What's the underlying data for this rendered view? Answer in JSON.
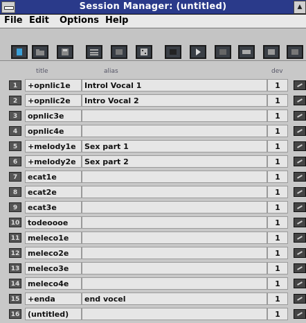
{
  "window": {
    "title": "Session Manager: (untitled)"
  },
  "menu": {
    "items": [
      "File",
      "Edit",
      "Options",
      "Help"
    ]
  },
  "toolbar": {
    "buttons": [
      {
        "name": "new-button",
        "icon": "document-icon"
      },
      {
        "name": "open-button",
        "icon": "folder-icon"
      },
      {
        "name": "save-button",
        "icon": "disk-icon"
      },
      {
        "name": "track-list-button",
        "icon": "list-icon"
      },
      {
        "name": "track-settings-button",
        "icon": "settings-icon"
      },
      {
        "name": "mixer-button",
        "icon": "mixer-icon"
      },
      {
        "name": "stop-button",
        "icon": "stop-icon"
      },
      {
        "name": "play-button",
        "icon": "play-icon"
      },
      {
        "name": "tool-button-9",
        "icon": "tool-icon"
      },
      {
        "name": "tool-button-10",
        "icon": "tool-icon"
      },
      {
        "name": "tool-button-11",
        "icon": "tool-icon"
      },
      {
        "name": "tool-button-12",
        "icon": "tool-icon"
      }
    ]
  },
  "columns": {
    "title": "title",
    "alias": "alias",
    "dev": "dev"
  },
  "rows": [
    {
      "num": "1",
      "title": "+opnlic1e",
      "alias": "Introl Vocal 1",
      "dev": "1"
    },
    {
      "num": "2",
      "title": "+opnlic2e",
      "alias": "Intro Vocal 2",
      "dev": "1"
    },
    {
      "num": "3",
      "title": "opnlic3e",
      "alias": "",
      "dev": "1"
    },
    {
      "num": "4",
      "title": "opnlic4e",
      "alias": "",
      "dev": "1"
    },
    {
      "num": "5",
      "title": "+melody1e",
      "alias": "Sex part 1",
      "dev": "1"
    },
    {
      "num": "6",
      "title": "+melody2e",
      "alias": "Sex part 2",
      "dev": "1"
    },
    {
      "num": "7",
      "title": "ecat1e",
      "alias": "",
      "dev": "1"
    },
    {
      "num": "8",
      "title": "ecat2e",
      "alias": "",
      "dev": "1"
    },
    {
      "num": "9",
      "title": "ecat3e",
      "alias": "",
      "dev": "1"
    },
    {
      "num": "10",
      "title": "todeoooe",
      "alias": "",
      "dev": "1"
    },
    {
      "num": "11",
      "title": "meleco1e",
      "alias": "",
      "dev": "1"
    },
    {
      "num": "12",
      "title": "meleco2e",
      "alias": "",
      "dev": "1"
    },
    {
      "num": "13",
      "title": "meleco3e",
      "alias": "",
      "dev": "1"
    },
    {
      "num": "14",
      "title": "meleco4e",
      "alias": "",
      "dev": "1"
    },
    {
      "num": "15",
      "title": "+enda",
      "alias": "end vocel",
      "dev": "1"
    },
    {
      "num": "16",
      "title": "(untitled)",
      "alias": "",
      "dev": "1"
    }
  ],
  "colors": {
    "titlebar": "#2a3a8a",
    "window": "#c8c8c8",
    "cell": "#e6e6e6"
  }
}
